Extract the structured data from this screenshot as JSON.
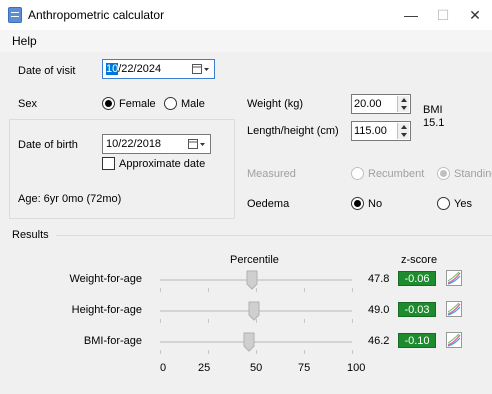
{
  "window": {
    "title": "Anthropometric calculator",
    "minimize_glyph": "—",
    "maximize_glyph": "☐",
    "close_glyph": "✕"
  },
  "menu": {
    "help": "Help"
  },
  "visit": {
    "label": "Date of visit",
    "value_highlight": "10",
    "value_rest": "/22/2024"
  },
  "sex": {
    "label": "Sex",
    "female": "Female",
    "male": "Male",
    "selected": "Female"
  },
  "dob": {
    "label": "Date of birth",
    "value": "10/22/2018",
    "approximate_label": "Approximate date",
    "approximate_checked": false,
    "age": "Age: 6yr 0mo (72mo)"
  },
  "weight": {
    "label": "Weight (kg)",
    "value": "20.00"
  },
  "length": {
    "label": "Length/height (cm)",
    "value": "115.00"
  },
  "bmi": {
    "label": "BMI",
    "value": "15.1"
  },
  "measured": {
    "label": "Measured",
    "recumbent": "Recumbent",
    "standing": "Standing",
    "selected": "Standing",
    "enabled": false
  },
  "oedema": {
    "label": "Oedema",
    "no": "No",
    "yes": "Yes",
    "selected": "No"
  },
  "results": {
    "title": "Results",
    "percentile_header": "Percentile",
    "zscore_header": "z-score",
    "scale": [
      "0",
      "25",
      "50",
      "75",
      "100"
    ],
    "rows": [
      {
        "label": "Weight-for-age",
        "percentile": "47.8",
        "percentile_value": 47.8,
        "zscore": "-0.06",
        "chart_icon": "growth-chart-icon"
      },
      {
        "label": "Height-for-age",
        "percentile": "49.0",
        "percentile_value": 49.0,
        "zscore": "-0.03",
        "chart_icon": "growth-chart-icon"
      },
      {
        "label": "BMI-for-age",
        "percentile": "46.2",
        "percentile_value": 46.2,
        "zscore": "-0.10",
        "chart_icon": "growth-chart-icon"
      }
    ]
  },
  "colors": {
    "selection": "#0078d7",
    "zscore_bg": "#1e8c2e",
    "disabled_text": "#a0a0a0"
  }
}
